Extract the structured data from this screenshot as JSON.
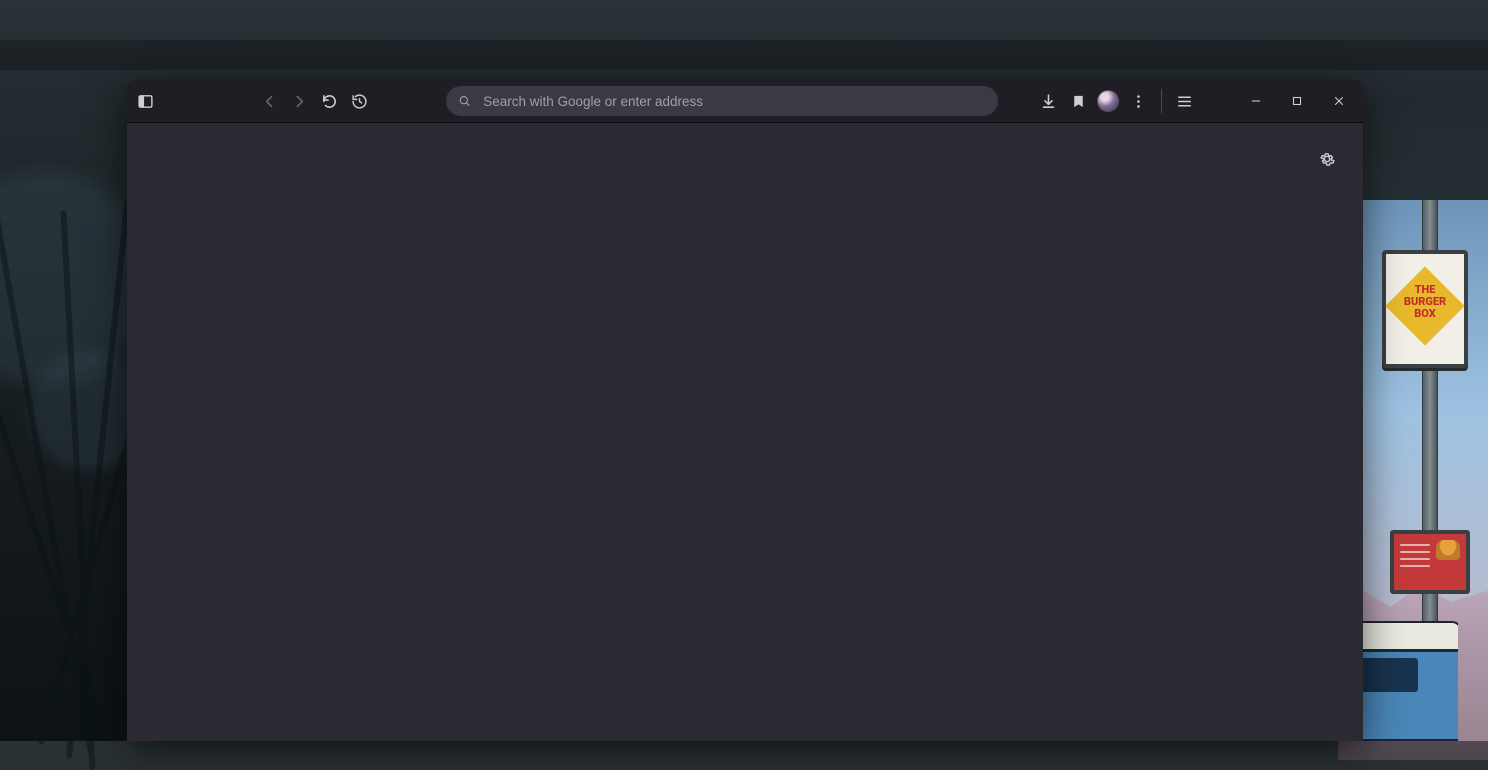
{
  "wallpaper": {
    "sign_line1": "THE",
    "sign_line2": "BURGER",
    "sign_line3": "BOX"
  },
  "browser": {
    "urlbar_placeholder": "Search with Google or enter address"
  }
}
